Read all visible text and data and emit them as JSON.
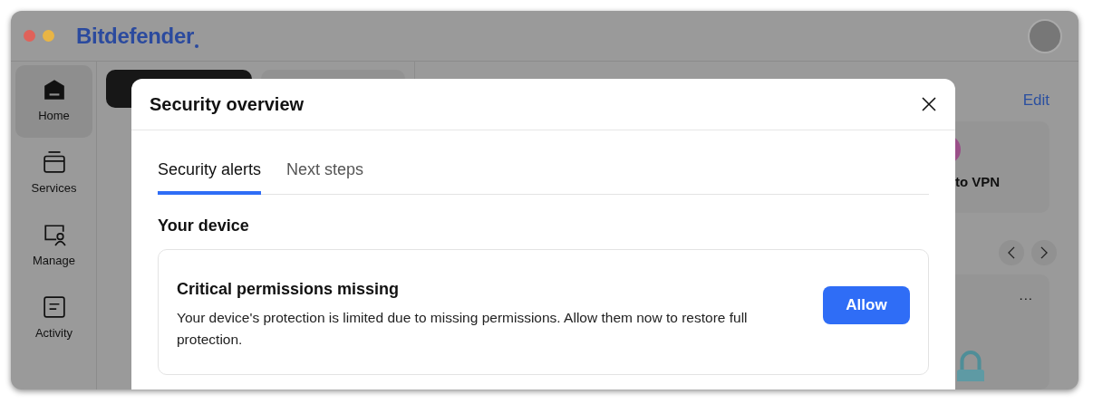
{
  "window": {
    "logo": "Bitdefender"
  },
  "sidebar": {
    "items": [
      {
        "label": "Home",
        "selected": true
      },
      {
        "label": "Services",
        "selected": false
      },
      {
        "label": "Manage",
        "selected": false
      },
      {
        "label": "Activity",
        "selected": false
      }
    ]
  },
  "background": {
    "edit_link": "Edit",
    "card_text": "to VPN",
    "tile_menu": "..."
  },
  "modal": {
    "title": "Security overview",
    "tabs": [
      {
        "label": "Security alerts",
        "selected": true
      },
      {
        "label": "Next steps",
        "selected": false
      }
    ],
    "section_title": "Your device",
    "alert": {
      "title": "Critical permissions missing",
      "message": "Your device's protection is limited due to missing permissions. Allow them now to restore full protection.",
      "button": "Allow"
    }
  }
}
